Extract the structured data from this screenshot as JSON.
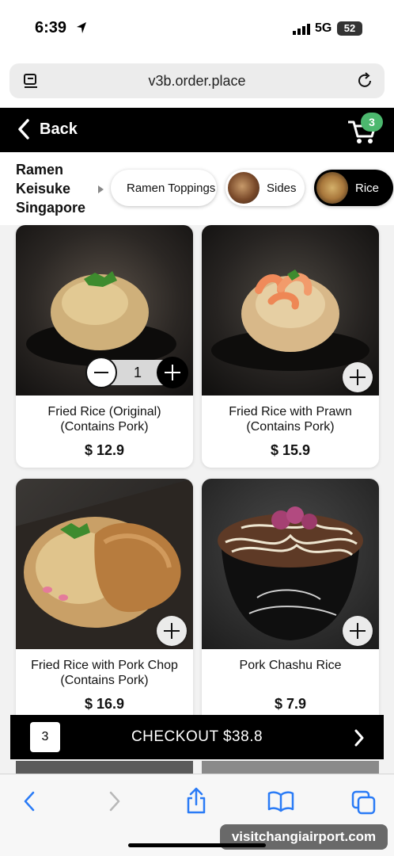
{
  "status_bar": {
    "time": "6:39",
    "network": "5G",
    "battery": "52"
  },
  "browser": {
    "url": "v3b.order.place"
  },
  "header": {
    "back_label": "Back",
    "cart_count": "3"
  },
  "restaurant": {
    "name": "Ramen Keisuke Singapore"
  },
  "categories": [
    {
      "label": "Ramen Toppings",
      "active": false
    },
    {
      "label": "Sides",
      "active": false
    },
    {
      "label": "Rice",
      "active": true
    }
  ],
  "products": [
    {
      "name": "Fried Rice (Original) (Contains Pork)",
      "price": "$ 12.9",
      "quantity": "1"
    },
    {
      "name": "Fried Rice with Prawn (Contains Pork)",
      "price": "$ 15.9"
    },
    {
      "name": "Fried Rice with Pork Chop (Contains Pork)",
      "price": "$ 16.9"
    },
    {
      "name": "Pork Chashu Rice",
      "price": "$ 7.9"
    }
  ],
  "checkout": {
    "count": "3",
    "label": "CHECKOUT $38.8"
  },
  "watermark": "visitchangiairport.com"
}
